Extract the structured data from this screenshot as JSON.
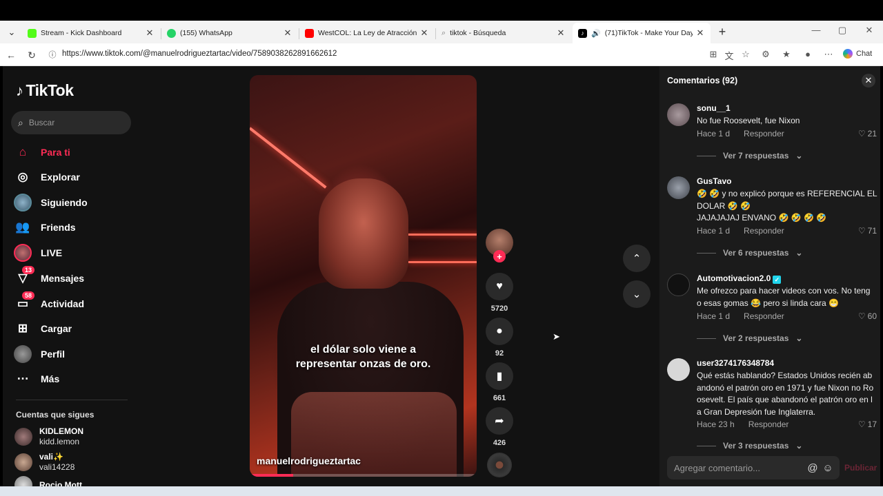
{
  "browser": {
    "tabs": [
      {
        "label": "Stream - Kick Dashboard",
        "favicon_color": "#53fc18"
      },
      {
        "label": "(155) WhatsApp",
        "favicon_color": "#25d366"
      },
      {
        "label": "WestCOL: La Ley de Atracción en P",
        "favicon_color": "#ff0000"
      },
      {
        "label": "tiktok - Búsqueda",
        "favicon_color": "#9aa0a6"
      },
      {
        "label": "(71)TikTok - Make Your Day",
        "favicon_color": "#000000"
      }
    ],
    "url": "https://www.tiktok.com/@manuelrodrigueztartac/video/758903826289166261​2",
    "chat_label": "Chat"
  },
  "sidebar": {
    "logo": "TikTok",
    "search_placeholder": "Buscar",
    "nav": [
      {
        "label": "Para ti",
        "icon": "home-icon",
        "active": true
      },
      {
        "label": "Explorar",
        "icon": "compass-icon"
      },
      {
        "label": "Siguiendo",
        "icon": "following-avatar-icon"
      },
      {
        "label": "Friends",
        "icon": "friends-icon"
      },
      {
        "label": "LIVE",
        "icon": "live-icon"
      },
      {
        "label": "Mensajes",
        "icon": "messages-icon",
        "badge": "13"
      },
      {
        "label": "Actividad",
        "icon": "activity-icon",
        "badge": "58"
      },
      {
        "label": "Cargar",
        "icon": "upload-icon"
      },
      {
        "label": "Perfil",
        "icon": "profile-avatar-icon"
      },
      {
        "label": "Más",
        "icon": "more-icon"
      }
    ],
    "following_title": "Cuentas que sigues",
    "following": [
      {
        "name": "KIDLEMON",
        "user": "kidd.lemon"
      },
      {
        "name": "vali✨",
        "user": "vali14228"
      },
      {
        "name": "Rocio Mott",
        "user": ""
      }
    ]
  },
  "video": {
    "caption_line1": "el dólar solo viene a",
    "caption_line2": "representar onzas de oro.",
    "author": "manuelrodrigueztartac",
    "progress": 0.19
  },
  "actions": {
    "likes": "5720",
    "comments": "92",
    "saves": "661",
    "shares": "426"
  },
  "comments_panel": {
    "title": "Comentarios (92)",
    "input_placeholder": "Agregar comentario...",
    "publish_label": "Publicar",
    "items": [
      {
        "user": "sonu__1",
        "lines": [
          "No fue Roosevelt, fue Nixon"
        ],
        "time": "Hace 1 d",
        "reply": "Responder",
        "likes": "21",
        "replies": "Ver 7 respuestas",
        "avatar_color": "#8a7a7e"
      },
      {
        "user": "GusTavo",
        "lines": [
          "🤣 🤣  y no explicó porque es REFERENCIAL EL",
          "DOLAR 🤣 🤣",
          "JAJAJAJAJ ENVANO 🤣 🤣 🤣 🤣"
        ],
        "time": "Hace 1 d",
        "reply": "Responder",
        "likes": "71",
        "replies": "Ver 6 respuestas",
        "avatar_color": "#6b6f78"
      },
      {
        "user": "Automotivacion2.0",
        "verified": "✓",
        "lines": [
          "Me ofrezco para hacer videos con vos. No teng",
          "o esas gomas 😂 pero si linda cara 😁"
        ],
        "time": "Hace 1 d",
        "reply": "Responder",
        "likes": "60",
        "replies": "Ver 2 respuestas",
        "avatar_color": "#111111"
      },
      {
        "user": "user3274176348784",
        "lines": [
          "Qué estás hablando? Estados Unidos recién ab",
          "andonó el patrón oro en 1971 y fue Nixon no Ro",
          "osevelt. El país que abandonó el patrón oro en l",
          "a Gran Depresión fue Inglaterra."
        ],
        "time": "Hace 23 h",
        "reply": "Responder",
        "likes": "17",
        "replies": "Ver 3 respuestas",
        "avatar_color": "#d8d8d8"
      }
    ]
  }
}
